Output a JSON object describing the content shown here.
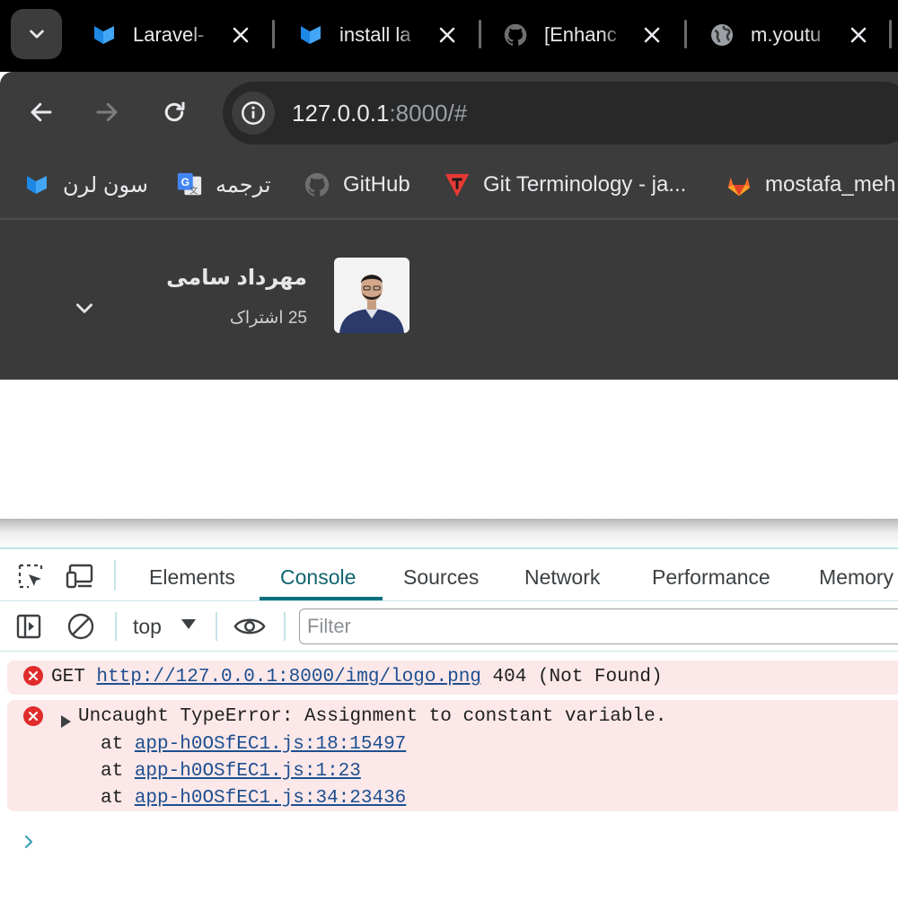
{
  "browser": {
    "tabs": [
      {
        "title": "Laravel-",
        "favicon": "laravel-icon"
      },
      {
        "title": "install la",
        "favicon": "laravel-icon"
      },
      {
        "title": "[Enhanc",
        "favicon": "github-icon"
      },
      {
        "title": "m.youtu",
        "favicon": "globe-icon"
      }
    ],
    "address": {
      "host": "127.0.0.1",
      "rest": ":8000/#"
    },
    "bookmarks": [
      {
        "label": "سون لرن",
        "icon": "sevenlearn-icon"
      },
      {
        "label": "ترجمه",
        "icon": "google-translate-icon"
      },
      {
        "label": "GitHub",
        "icon": "github-icon"
      },
      {
        "label": "Git Terminology - ja...",
        "icon": "git-terminology-icon"
      },
      {
        "label": "mostafa_meh",
        "icon": "gitlab-icon"
      }
    ]
  },
  "page": {
    "profile": {
      "name": "مهرداد سامی",
      "subscriptions": "25 اشتراک",
      "avatar": "avatar-photo"
    }
  },
  "devtools": {
    "tabs": [
      "Elements",
      "Console",
      "Sources",
      "Network",
      "Performance",
      "Memory"
    ],
    "active_tab": "Console",
    "context": "top",
    "filter_placeholder": "Filter",
    "messages": [
      {
        "method": "GET",
        "url": "http://127.0.0.1:8000/img/logo.png",
        "status": "404 (Not Found)"
      },
      {
        "text": "Uncaught TypeError: Assignment to constant variable.",
        "stack_prefix": "at",
        "stack": [
          "app-h0OSfEC1.js:18:15497",
          "app-h0OSfEC1.js:1:23",
          "app-h0OSfEC1.js:34:23436"
        ]
      }
    ]
  },
  "colors": {
    "tab_strip": "#000000",
    "toolbar": "#3c3c3c",
    "page_header": "#3a3a3a",
    "devtools_accent": "#0e6f7d",
    "error_background": "#fce8e8",
    "error_icon": "#e02b2b"
  }
}
